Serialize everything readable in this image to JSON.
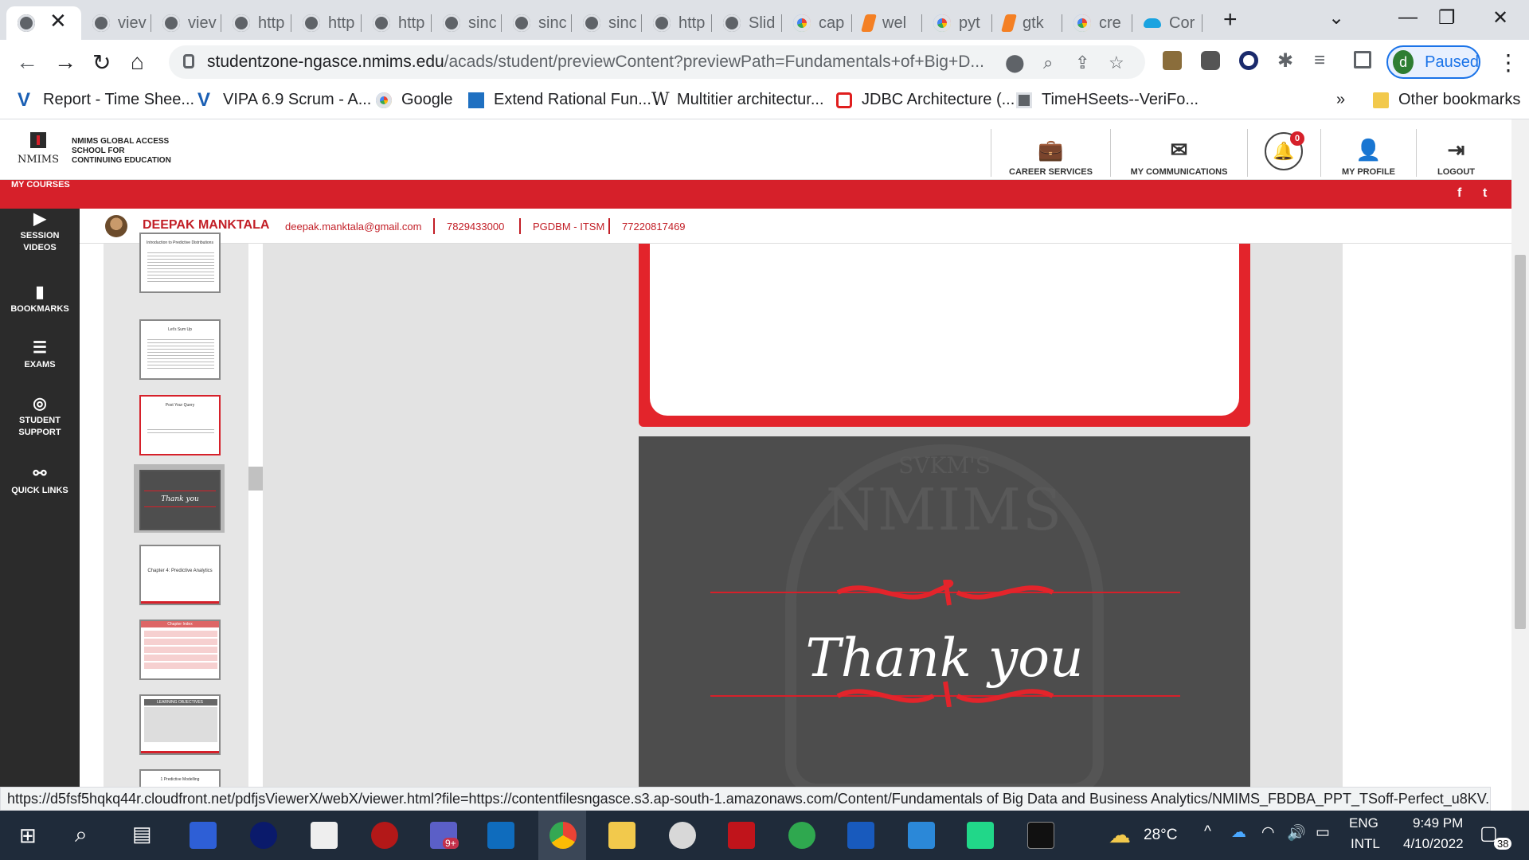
{
  "browser": {
    "tabs": [
      {
        "label": "",
        "icon": "globe-icon"
      },
      {
        "label": "viev",
        "icon": "globe-icon"
      },
      {
        "label": "viev",
        "icon": "globe-icon"
      },
      {
        "label": "http",
        "icon": "globe-icon"
      },
      {
        "label": "http",
        "icon": "globe-icon"
      },
      {
        "label": "http",
        "icon": "globe-icon"
      },
      {
        "label": "sinc",
        "icon": "globe-icon"
      },
      {
        "label": "sinc",
        "icon": "globe-icon"
      },
      {
        "label": "sinc",
        "icon": "globe-icon"
      },
      {
        "label": "http",
        "icon": "globe-icon"
      },
      {
        "label": "Slid",
        "icon": "globe-icon"
      },
      {
        "label": "cap",
        "icon": "google-icon"
      },
      {
        "label": "wel",
        "icon": "stackoverflow-icon"
      },
      {
        "label": "pyt",
        "icon": "google-icon"
      },
      {
        "label": "gtk",
        "icon": "stackoverflow-icon"
      },
      {
        "label": "cre",
        "icon": "google-icon"
      },
      {
        "label": "Cor",
        "icon": "cloud-icon"
      }
    ],
    "new_tab": "+",
    "url_host": "studentzone-ngasce.nmims.edu",
    "url_path": "/acads/student/previewContent?previewPath=Fundamentals+of+Big+D...",
    "profile_initial": "d",
    "profile_status": "Paused",
    "bookmarks": [
      {
        "label": "Report - Time Shee...",
        "icon": "vipa-icon"
      },
      {
        "label": "VIPA 6.9 Scrum - A...",
        "icon": "vipa-icon"
      },
      {
        "label": "Google",
        "icon": "google-icon"
      },
      {
        "label": "Extend Rational Fun...",
        "icon": "ibm-icon"
      },
      {
        "label": "Multitier architectur...",
        "icon": "wikipedia-icon"
      },
      {
        "label": "JDBC Architecture (...",
        "icon": "oracle-icon"
      },
      {
        "label": "TimeHSeets--VeriFo...",
        "icon": "globe-icon"
      }
    ],
    "bookmarks_more": "»",
    "other_bookmarks": "Other bookmarks",
    "status_url": "https://d5fsf5hqkq44r.cloudfront.net/pdfjsViewerX/webX/viewer.html?file=https://contentfilesngasce.s3.ap-south-1.amazonaws.com/Content/Fundamentals of Big Data and Business Analytics/NMIMS_FBDBA_PPT_TSoff-Perfect_u8KV..."
  },
  "portal": {
    "logo_text": "NMIMS",
    "school_name_1": "NMIMS GLOBAL ACCESS",
    "school_name_2": "SCHOOL FOR",
    "school_name_3": "CONTINUING EDUCATION",
    "nav": {
      "career": "CAREER SERVICES",
      "communications": "MY COMMUNICATIONS",
      "notifications_count": "0",
      "profile": "MY PROFILE",
      "logout": "LOGOUT"
    },
    "my_courses": "MY COURSES",
    "social_facebook": "f",
    "social_twitter": "t",
    "sidebar": [
      {
        "label_1": "SESSION",
        "label_2": "VIDEOS",
        "icon": "play-circle-icon"
      },
      {
        "label_1": "BOOKMARKS",
        "label_2": "",
        "icon": "bookmark-icon"
      },
      {
        "label_1": "EXAMS",
        "label_2": "",
        "icon": "exam-icon"
      },
      {
        "label_1": "STUDENT",
        "label_2": "SUPPORT",
        "icon": "lifebuoy-icon"
      },
      {
        "label_1": "QUICK LINKS",
        "label_2": "",
        "icon": "link-icon"
      }
    ],
    "user": {
      "name": "DEEPAK MANKTALA",
      "email": "deepak.manktala@gmail.com",
      "phone": "7829433000",
      "program": "PGDBM - ITSM",
      "student_id": "77220817469"
    }
  },
  "viewer": {
    "thumbnails": [
      {
        "title": "Introduction to Predictive Distributions",
        "kind": "text"
      },
      {
        "title": "Let's Sum Up",
        "kind": "text"
      },
      {
        "title": "Post Your Query",
        "kind": "text"
      },
      {
        "title": "Thank you",
        "kind": "thankyou",
        "selected": true
      },
      {
        "title": "Chapter 4: Predictive Analytics",
        "kind": "title"
      },
      {
        "title": "Chapter Index",
        "kind": "table"
      },
      {
        "title": "LEARNING OBJECTIVES",
        "kind": "objectives"
      },
      {
        "title": "1 Predictive Modelling",
        "kind": "text"
      }
    ],
    "slide_watermark_small": "SVKM'S",
    "slide_watermark": "NMIMS",
    "slide_text": "Thank you"
  },
  "taskbar": {
    "temperature": "28°C",
    "lang_1": "ENG",
    "lang_2": "INTL",
    "time": "9:49 PM",
    "date": "4/10/2022",
    "notifications": "38",
    "teams_badge": "9+"
  },
  "colors": {
    "brand_red": "#d6202a",
    "sidebar_dark": "#2b2b2b",
    "slide_gray": "#4d4d4d"
  }
}
